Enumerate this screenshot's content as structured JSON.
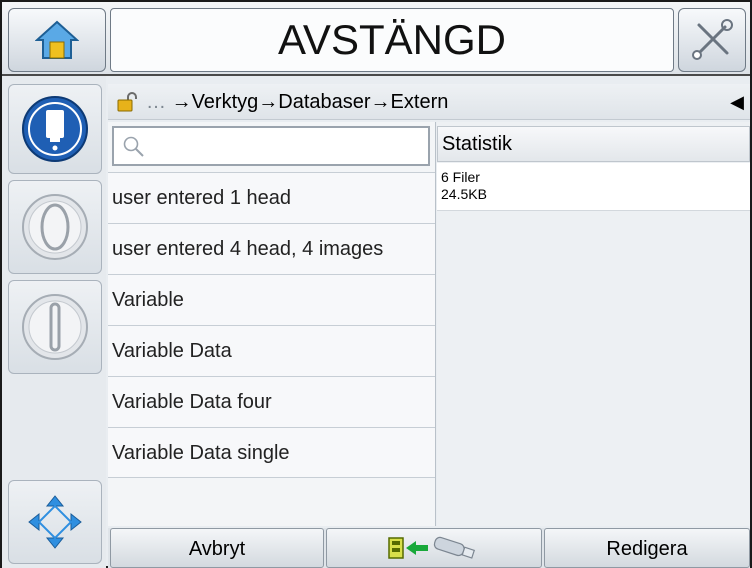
{
  "header": {
    "status": "AVSTÄNGD",
    "home_icon": "home-icon",
    "tools_icon": "tools-icon"
  },
  "sidebar": {
    "buttons": [
      {
        "icon": "printhead-icon"
      },
      {
        "icon": "start-icon"
      },
      {
        "icon": "stop-icon"
      },
      {
        "icon": "navigation-arrows-icon"
      }
    ]
  },
  "breadcrumb": {
    "ellipsis": "…",
    "parts": [
      "→Verktyg",
      "→Databaser",
      "→Extern"
    ],
    "back_icon": "back-arrow-icon"
  },
  "search": {
    "placeholder": ""
  },
  "files": [
    "user entered 1 head",
    "user entered 4 head, 4 images",
    "Variable",
    "Variable Data",
    "Variable Data four",
    "Variable Data single"
  ],
  "stats": {
    "header": "Statistik",
    "files_count": "6 Filer",
    "size": "24.5KB"
  },
  "footer": {
    "cancel_label": "Avbryt",
    "import_icon": "usb-import-icon",
    "edit_label": "Redigera"
  }
}
